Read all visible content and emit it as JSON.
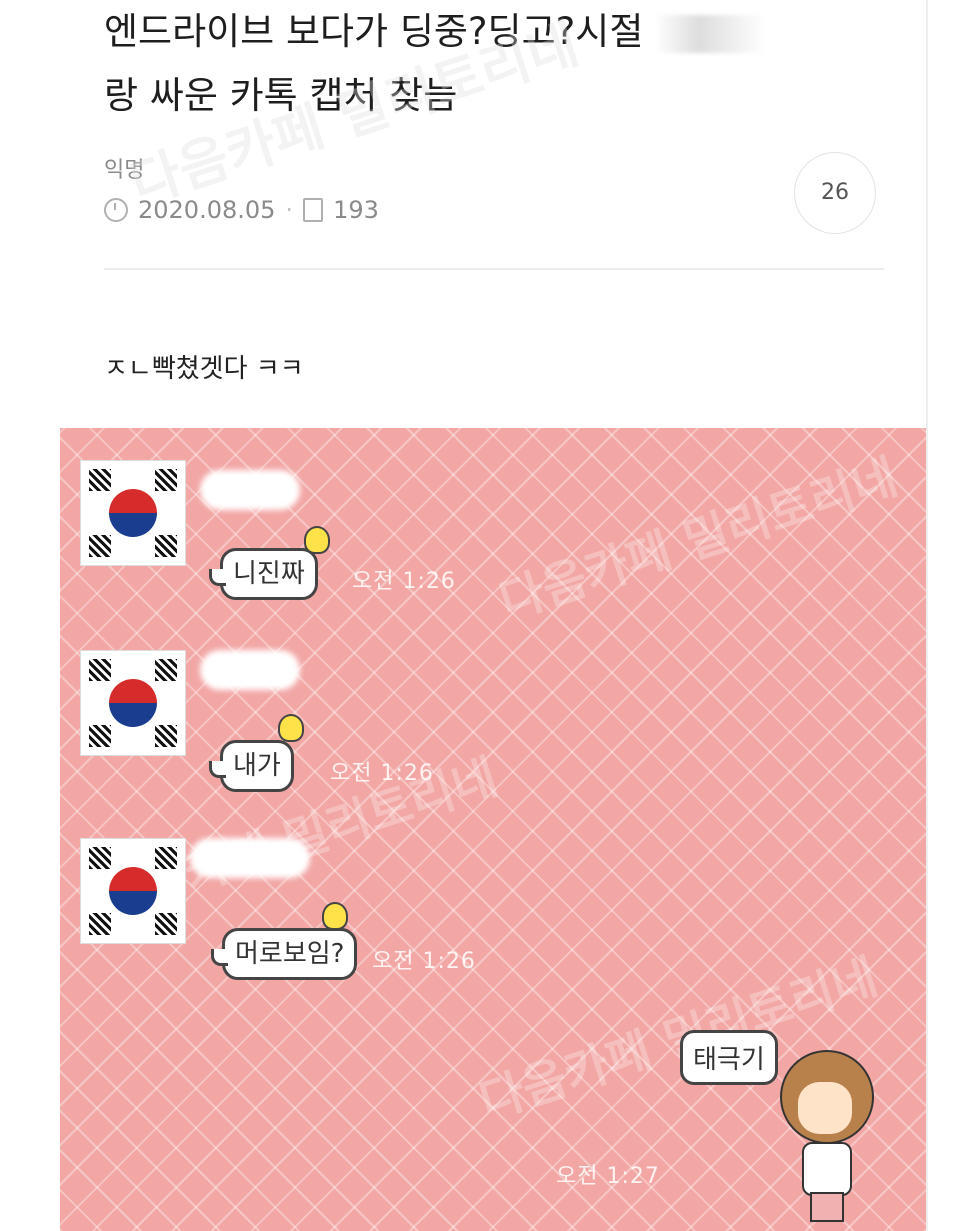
{
  "post": {
    "title_part1": "엔드라이브 보다가 딩중?딩고?시절 ",
    "title_part2": "랑 싸운 카톡 캡처 찾늠",
    "author": "익명",
    "date": "2020.08.05",
    "views": "193",
    "comment_count": "26",
    "body_text": "ㅈㄴ빡쳤겟다 ㅋㅋ"
  },
  "watermarks": {
    "primary": "다음카페 밀리토리네"
  },
  "chat": {
    "messages": [
      {
        "text": "니진짜",
        "time": "오전 1:26"
      },
      {
        "text": "내가",
        "time": "오전 1:26"
      },
      {
        "text": "머로보임?",
        "time": "오전 1:26"
      }
    ],
    "my_message": {
      "text": "태극기",
      "time": "오전 1:27"
    }
  }
}
